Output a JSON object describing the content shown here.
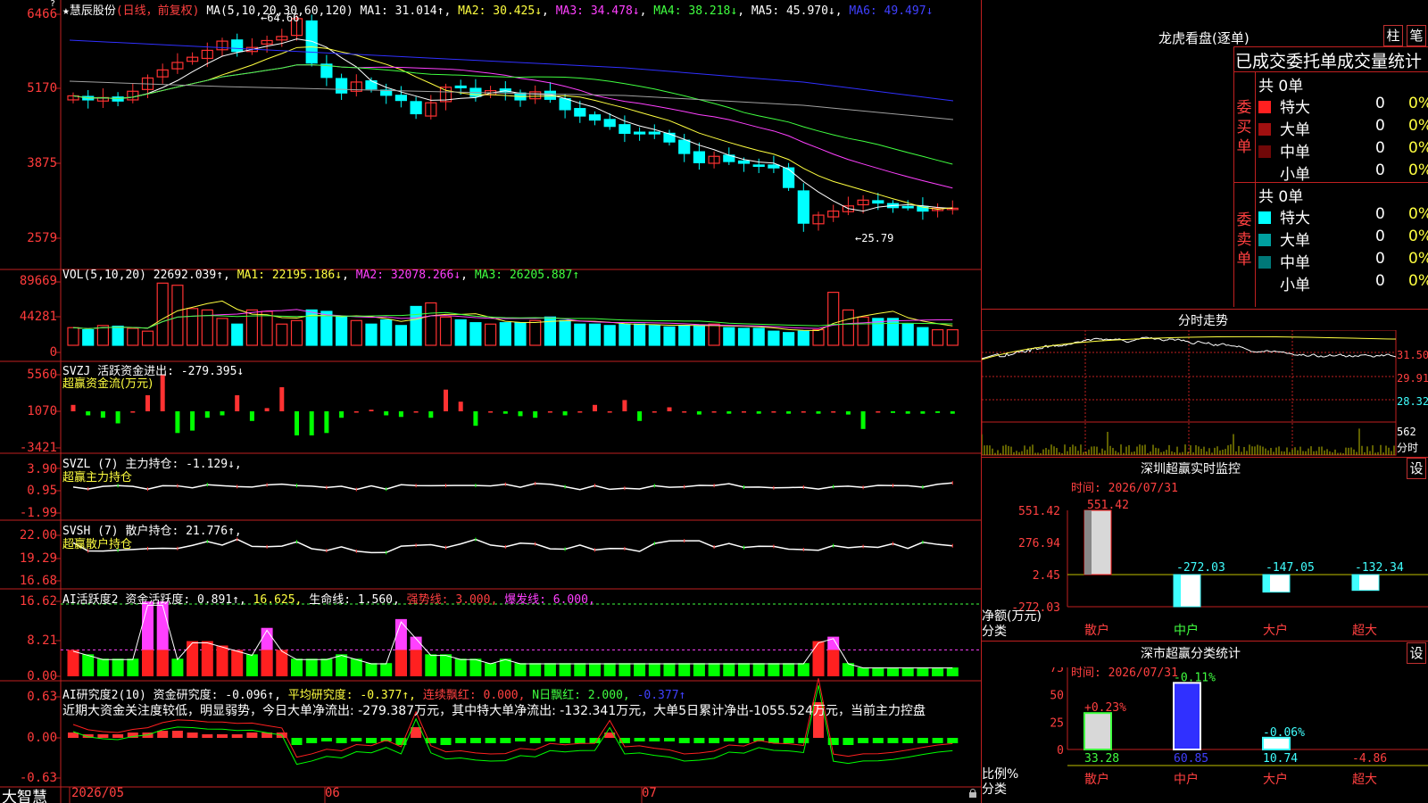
{
  "colors": {
    "up": "#ff3232",
    "down": "#00ffff",
    "grid": "#c02020",
    "ma1": "#ffffff",
    "ma2": "#ffff40",
    "ma3": "#ff40ff",
    "ma4": "#40ff40",
    "ma5": "#a0a0a0",
    "ma6": "#3030ff"
  },
  "main": {
    "header": {
      "star": "★",
      "stock": "慧辰股份",
      "period": "(日线，前复权)",
      "ma_params": "MA(5,10,20,30,60,120)",
      "ma1": "MA1: 31.014↑",
      "ma2": "MA2: 30.425↓",
      "ma3": "MA3: 34.478↓",
      "ma4": "MA4: 38.218↓",
      "ma5": "MA5: 45.970↓",
      "ma6": "MA6: 49.497↓"
    },
    "axis": [
      "6466",
      "5170",
      "3875",
      "2579"
    ],
    "high_label": "←64.66",
    "low_label": "←25.79",
    "question_icon": "question-mark-icon"
  },
  "vol": {
    "header": {
      "name": "VOL(5,10,20)",
      "value": "22692.039↑",
      "ma1": "MA1: 22195.186↓",
      "ma2": "MA2: 32078.266↓",
      "ma3": "MA3: 26205.887↑"
    },
    "axis": [
      "89669",
      "44281",
      "0"
    ]
  },
  "svzj": {
    "header": {
      "name": "SVZJ",
      "label": "活跃资金进出: -279.395↓",
      "sub": "超赢资金流(万元)"
    },
    "axis": [
      "5560",
      "1070",
      "-3421"
    ]
  },
  "svzl": {
    "header": {
      "name": "SVZL (7)",
      "label": "主力持仓: -1.129↓,",
      "sub": "超赢主力持仓"
    },
    "axis": [
      "3.90",
      "0.95",
      "-1.99"
    ]
  },
  "svsh": {
    "header": {
      "name": "SVSH (7)",
      "label": "散户持仓: 21.776↑,",
      "sub": "超赢散户持仓"
    },
    "axis": [
      "22.00",
      "19.29",
      "16.68"
    ]
  },
  "ai2": {
    "header": {
      "name": "AI活跃度2",
      "l1": "资金活跃度: 0.891↑,",
      "l2": "16.625,",
      "l3": "生命线: 1.560,",
      "l4": "强势线: 3.000,",
      "l5": "爆发线: 6.000,"
    },
    "axis": [
      "16.62",
      "8.21",
      "0.00"
    ]
  },
  "ai_research": {
    "header": {
      "name": "AI研究度2(10)",
      "l1": "资金研究度: -0.096↑,",
      "l2": "平均研究度: -0.377↑,",
      "l3": "连续飘红: 0.000,",
      "l4": "N日飘红: 2.000,",
      "l5": "-0.377↑"
    },
    "desc": "近期大资金关注度较低，明显弱势，今日大单净流出: -279.387万元，其中特大单净流出: -132.341万元，大单5日累计净出-1055.524万元，当前主力控盘",
    "axis": [
      "0.63",
      "0.00",
      "-0.63"
    ]
  },
  "footer": {
    "brand": "大智慧",
    "dates": [
      "2026/05",
      "06",
      "07"
    ],
    "lock_icon": "lock-icon"
  },
  "dragon": {
    "title": "龙虎看盘(逐单)",
    "btn1": "柱",
    "btn2": "笔",
    "subtitle": "已成交委托单成交量统计",
    "buy": {
      "side": "委买单",
      "total": "共 0单",
      "rows": [
        {
          "label": "特大",
          "vol": "0",
          "pct": "0%",
          "color": "#ff2020"
        },
        {
          "label": "大单",
          "vol": "0",
          "pct": "0%",
          "color": "#a01010"
        },
        {
          "label": "中单",
          "vol": "0",
          "pct": "0%",
          "color": "#700808"
        },
        {
          "label": "小单",
          "vol": "0",
          "pct": "0%",
          "color": ""
        }
      ]
    },
    "sell": {
      "side": "委卖单",
      "total": "共 0单",
      "rows": [
        {
          "label": "特大",
          "vol": "0",
          "pct": "0%",
          "color": "#00ffff"
        },
        {
          "label": "大单",
          "vol": "0",
          "pct": "0%",
          "color": "#00a0a0"
        },
        {
          "label": "中单",
          "vol": "0",
          "pct": "0%",
          "color": "#007878"
        },
        {
          "label": "小单",
          "vol": "0",
          "pct": "0%",
          "color": ""
        }
      ]
    }
  },
  "intraday": {
    "title": "分时走势",
    "axis": [
      "31.50",
      "29.91",
      "28.32"
    ],
    "vol_axis": [
      "562",
      "分时"
    ]
  },
  "sz_monitor": {
    "title": "深圳超赢实时监控",
    "btn": "设",
    "time": "时间: 2026/07/31",
    "axis": [
      "551.42",
      "276.94",
      "2.45",
      "-272.03"
    ],
    "ylabel": "净额(万元)",
    "xlabel": "分类",
    "chart_data": {
      "type": "bar",
      "categories": [
        "散户",
        "中户",
        "大户",
        "超大"
      ],
      "values": [
        551.42,
        -272.03,
        -147.05,
        -132.34
      ],
      "ylim": [
        -272.03,
        551.42
      ]
    }
  },
  "cls_stat": {
    "title": "深市超赢分类统计",
    "btn": "设",
    "time": "时间: 2026/07/31",
    "axis": [
      "75",
      "50",
      "25",
      "0"
    ],
    "ylabel": "比例%",
    "xlabel": "分类",
    "chart_data": {
      "type": "bar",
      "categories": [
        "散户",
        "中户",
        "大户",
        "超大"
      ],
      "values": [
        33.28,
        60.85,
        10.74,
        -4.86
      ],
      "changes": [
        "+0.23%",
        "-0.11%",
        "-0.06%",
        ""
      ],
      "ylim": [
        0,
        75
      ]
    }
  }
}
